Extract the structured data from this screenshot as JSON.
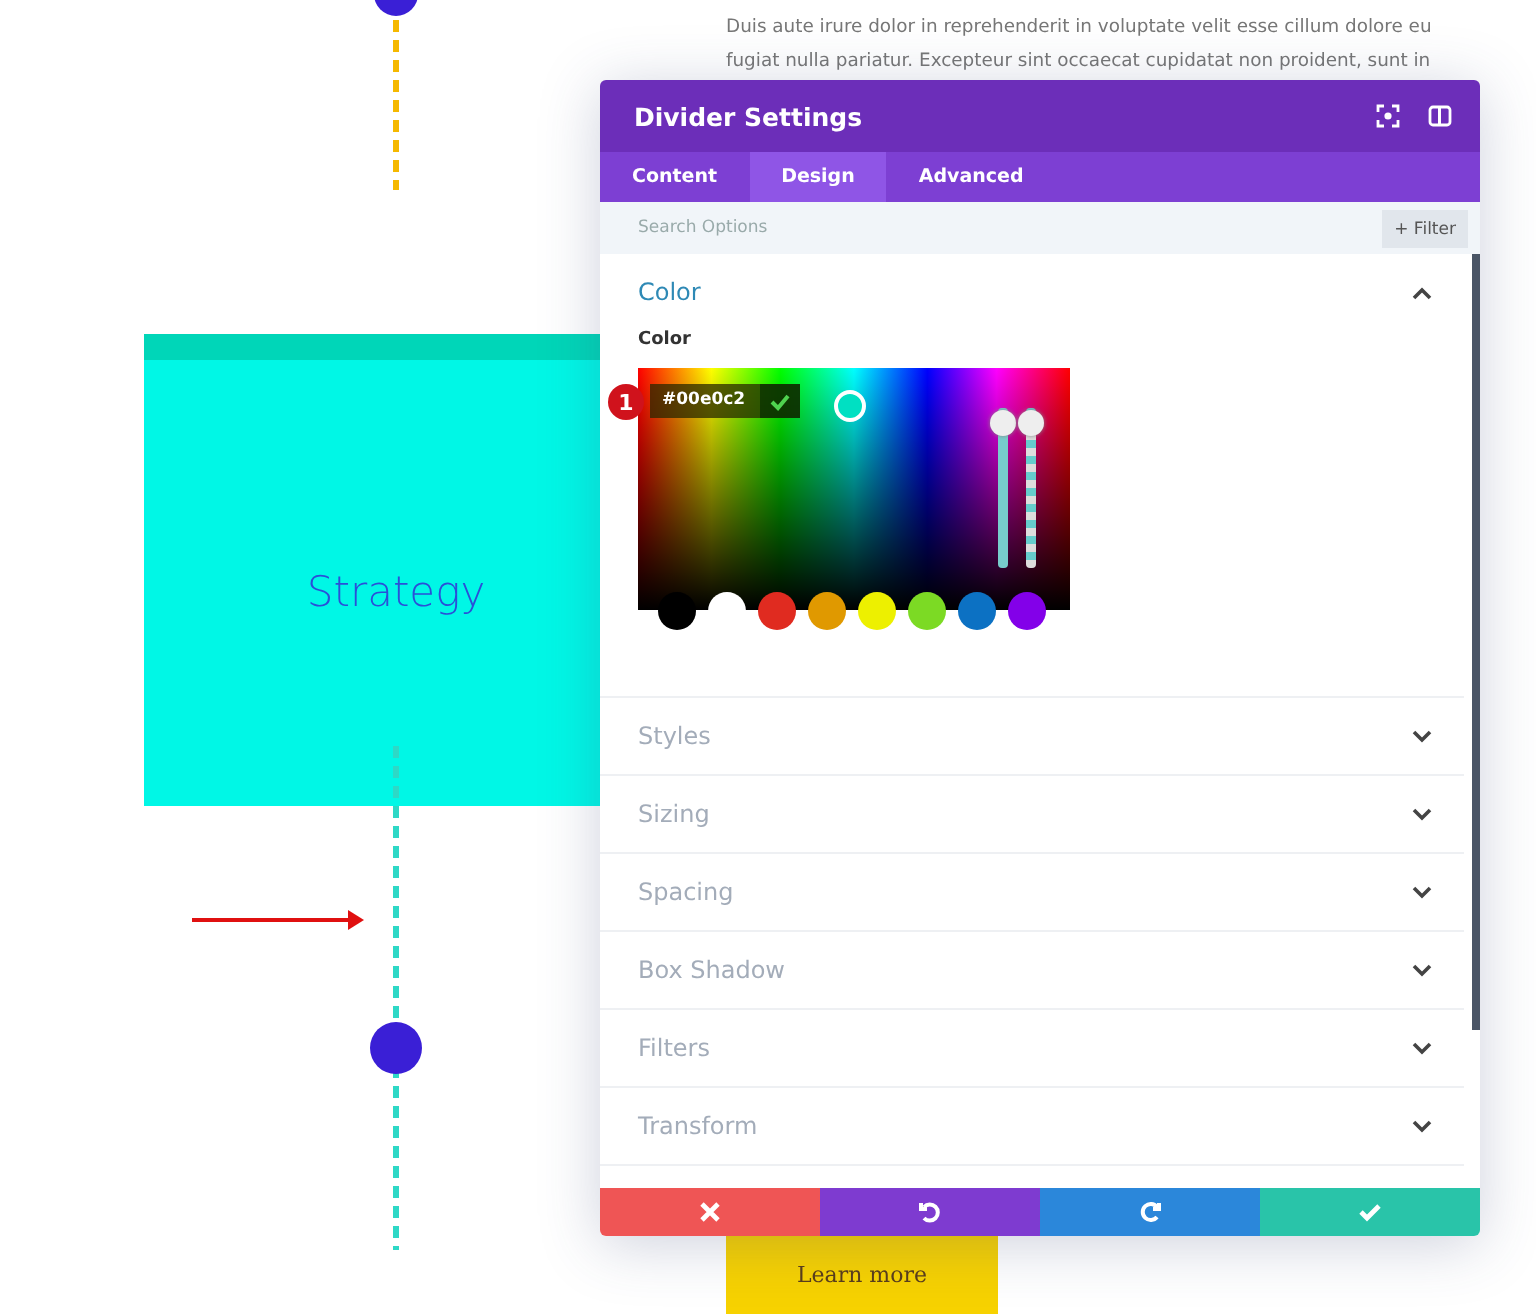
{
  "page_text": [
    "Duis aute irure dolor in reprehenderit in voluptate velit esse cillum dolore eu",
    "fugiat nulla pariatur. Excepteur sint occaecat cupidatat non proident, sunt in"
  ],
  "strategy_box": {
    "title": "Strategy"
  },
  "learn_more": "Learn more",
  "panel": {
    "title": "Divider Settings",
    "tabs": [
      {
        "label": "Content",
        "selected": false
      },
      {
        "label": "Design",
        "selected": true
      },
      {
        "label": "Advanced",
        "selected": false
      }
    ],
    "search": {
      "placeholder": "Search Options"
    },
    "filter_button": "Filter",
    "filter_icon": "+",
    "sections": [
      {
        "title": "Color",
        "expanded": true
      },
      {
        "title": "Styles",
        "expanded": false
      },
      {
        "title": "Sizing",
        "expanded": false
      },
      {
        "title": "Spacing",
        "expanded": false
      },
      {
        "title": "Box Shadow",
        "expanded": false
      },
      {
        "title": "Filters",
        "expanded": false
      },
      {
        "title": "Transform",
        "expanded": false
      }
    ],
    "color_field": {
      "label": "Color",
      "value": "#00e0c2",
      "badge": "1",
      "sliders": [
        {
          "kind": "hue",
          "level": 1
        },
        {
          "kind": "opacity",
          "level": 1
        }
      ],
      "swatches": [
        {
          "color": "#000000"
        },
        {
          "color": "#ffffff"
        },
        {
          "color": "#e02b20"
        },
        {
          "color": "#e09900"
        },
        {
          "color": "#edf000"
        },
        {
          "color": "#7cda24"
        },
        {
          "color": "#0c71c3"
        },
        {
          "color": "#8300e9"
        }
      ]
    },
    "footer_buttons": [
      {
        "kind": "cancel"
      },
      {
        "kind": "undo"
      },
      {
        "kind": "redo"
      },
      {
        "kind": "save"
      }
    ]
  }
}
